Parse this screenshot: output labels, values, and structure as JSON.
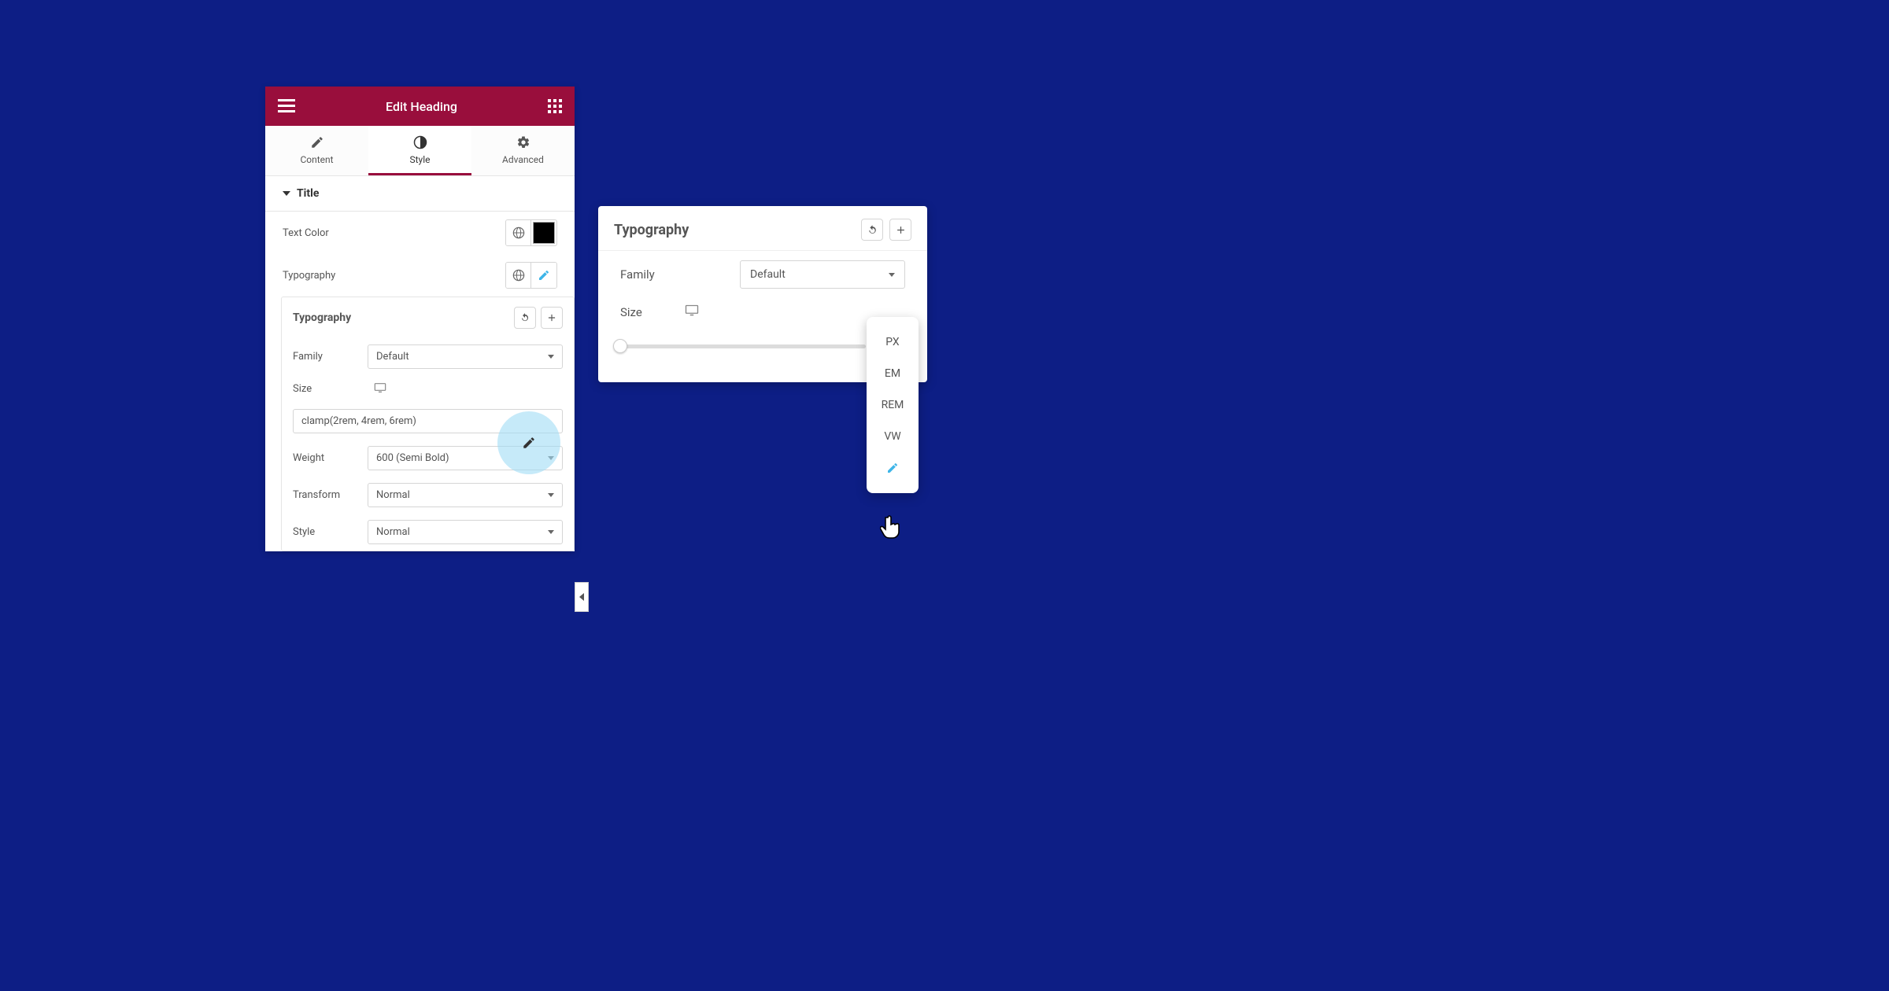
{
  "panel": {
    "title": "Edit Heading",
    "tabs": {
      "content": "Content",
      "style": "Style",
      "advanced": "Advanced"
    },
    "section_title": "Title",
    "text_color_label": "Text Color",
    "typography_label": "Typography"
  },
  "typography_inner": {
    "header": "Typography",
    "family_label": "Family",
    "family_value": "Default",
    "size_label": "Size",
    "size_value": "clamp(2rem, 4rem, 6rem)",
    "weight_label": "Weight",
    "weight_value": "600 (Semi Bold)",
    "transform_label": "Transform",
    "transform_value": "Normal",
    "style_label": "Style",
    "style_value": "Normal"
  },
  "popup": {
    "header": "Typography",
    "family_label": "Family",
    "family_value": "Default",
    "size_label": "Size"
  },
  "units": {
    "px": "PX",
    "em": "EM",
    "rem": "REM",
    "vw": "VW"
  }
}
